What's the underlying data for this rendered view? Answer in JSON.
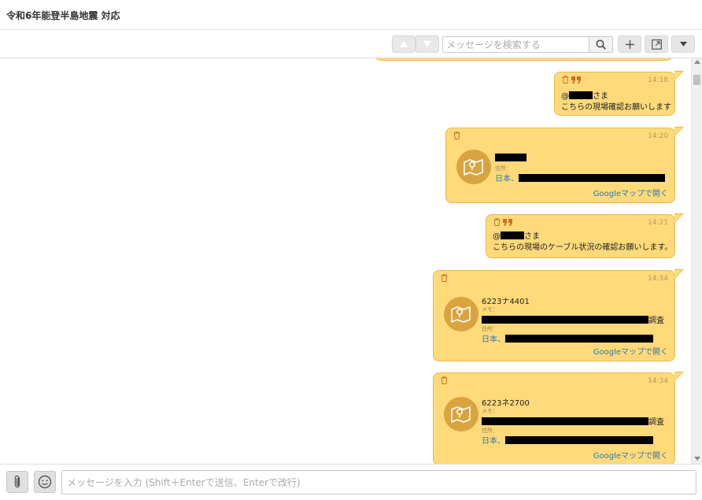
{
  "header": {
    "title": "令和6年能登半島地震 対応"
  },
  "toolbar": {
    "search_placeholder": "メッセージを検索する",
    "up_icon": "up-triangle",
    "down_icon": "down-triangle",
    "add_icon": "plus",
    "expand_icon": "popout",
    "menu_icon": "caret-down"
  },
  "messages": [
    {
      "time": "14:18",
      "mention_prefix": "@",
      "mention_suffix": "さま",
      "body": "こちらの現場確認お願いします"
    },
    {
      "time": "14:20",
      "address_label": "住所：",
      "address_prefix": "日本、",
      "map_link": "Googleマップで開く"
    },
    {
      "time": "14:21",
      "mention_prefix": "@",
      "mention_suffix": "さま",
      "body": "こちらの現場のケーブル状況の確認お願いします。"
    },
    {
      "time": "14:34",
      "pole": "6223ナ4401",
      "memo_label": "メモ：",
      "memo_suffix": "調査",
      "address_label": "住所：",
      "address_prefix": "日本、",
      "map_link": "Googleマップで開く"
    },
    {
      "time": "14:34",
      "pole": "6223ネ2700",
      "memo_label": "メモ：",
      "memo_suffix": "調査",
      "address_label": "住所：",
      "address_prefix": "日本、",
      "map_link": "Googleマップで開く"
    }
  ],
  "composer": {
    "placeholder": "メッセージを入力 (Shift＋Enterで送信、Enterで改行)"
  },
  "colors": {
    "bubble": "#ffda7a",
    "bubble_border": "#e8b84a",
    "link": "#2a7ab0",
    "map_icon_bg": "#d9a440"
  }
}
